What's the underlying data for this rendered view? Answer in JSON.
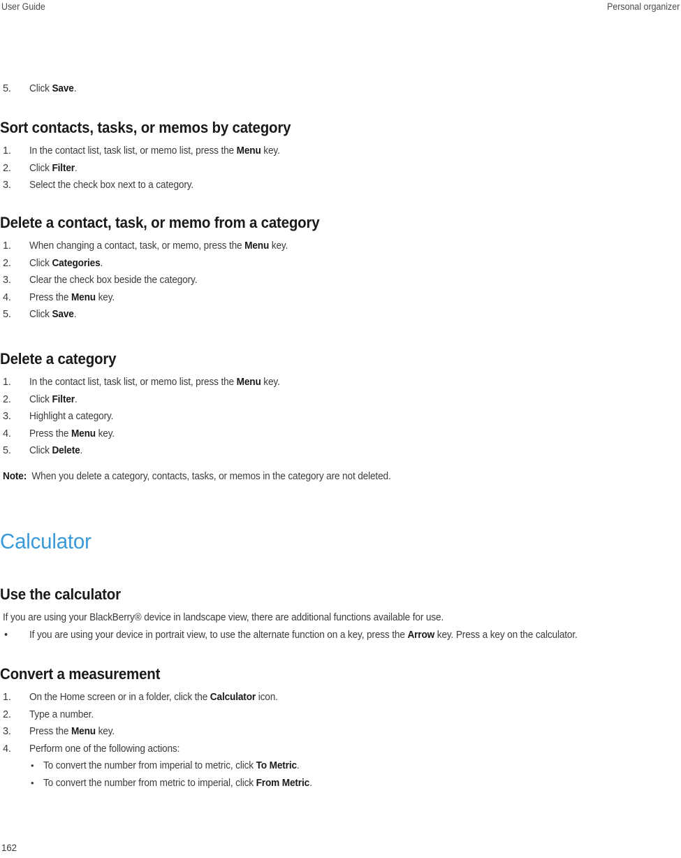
{
  "header": {
    "left": "User Guide",
    "right": "Personal organizer"
  },
  "footer": {
    "page_number": "162"
  },
  "colors": {
    "chapter_title": "#3a9ad9",
    "body_text": "#3b3b3b",
    "heading_text": "#1a1a1a",
    "page_background": "#ffffff"
  },
  "content": {
    "orphan_step": {
      "num": "5.",
      "text_before": "Click ",
      "bold": "Save",
      "text_after": "."
    },
    "section_sort": {
      "heading": "Sort contacts, tasks, or memos by category",
      "steps": [
        {
          "num": "1.",
          "before": "In the contact list, task list, or memo list, press the ",
          "bold": "Menu",
          "after": " key."
        },
        {
          "num": "2.",
          "before": "Click ",
          "bold": "Filter",
          "after": "."
        },
        {
          "num": "3.",
          "before": "Select the check box next to a category.",
          "bold": "",
          "after": ""
        }
      ]
    },
    "section_delete_from_category": {
      "heading": "Delete a contact, task, or memo from a category",
      "steps": [
        {
          "num": "1.",
          "before": "When changing a contact, task, or memo, press the ",
          "bold": "Menu",
          "after": " key."
        },
        {
          "num": "2.",
          "before": "Click ",
          "bold": "Categories",
          "after": "."
        },
        {
          "num": "3.",
          "before": "Clear the check box beside the category.",
          "bold": "",
          "after": ""
        },
        {
          "num": "4.",
          "before": "Press the ",
          "bold": "Menu",
          "after": " key."
        },
        {
          "num": "5.",
          "before": "Click ",
          "bold": "Save",
          "after": "."
        }
      ]
    },
    "section_delete_category": {
      "heading": "Delete a category",
      "steps": [
        {
          "num": "1.",
          "before": "In the contact list, task list, or memo list, press the ",
          "bold": "Menu",
          "after": " key."
        },
        {
          "num": "2.",
          "before": "Click ",
          "bold": "Filter",
          "after": "."
        },
        {
          "num": "3.",
          "before": "Highlight a category.",
          "bold": "",
          "after": ""
        },
        {
          "num": "4.",
          "before": "Press the ",
          "bold": "Menu",
          "after": " key."
        },
        {
          "num": "5.",
          "before": "Click ",
          "bold": "Delete",
          "after": "."
        }
      ],
      "note_label": "Note:",
      "note_text": "When you delete a category, contacts, tasks, or memos in the category are not deleted."
    },
    "chapter_calculator": {
      "title": "Calculator"
    },
    "section_use_calculator": {
      "heading": "Use the calculator",
      "intro": "If you are using your BlackBerry® device in landscape view, there are additional functions available for use.",
      "bullet": {
        "marker": "•",
        "before": "If you are using your device in portrait view, to use the alternate function on a key, press the ",
        "bold": "Arrow",
        "after": " key. Press a key on the calculator."
      }
    },
    "section_convert": {
      "heading": "Convert a measurement",
      "steps": [
        {
          "num": "1.",
          "before": "On the Home screen or in a folder, click the ",
          "bold": "Calculator",
          "after": " icon."
        },
        {
          "num": "2.",
          "before": "Type a number.",
          "bold": "",
          "after": ""
        },
        {
          "num": "3.",
          "before": "Press the ",
          "bold": "Menu",
          "after": " key."
        },
        {
          "num": "4.",
          "before": "Perform one of the following actions:",
          "bold": "",
          "after": ""
        }
      ],
      "sub_bullets": [
        {
          "marker": "•",
          "before": "To convert the number from imperial to metric, click ",
          "bold": "To Metric",
          "after": "."
        },
        {
          "marker": "•",
          "before": "To convert the number from metric to imperial, click ",
          "bold": "From Metric",
          "after": "."
        }
      ]
    }
  }
}
